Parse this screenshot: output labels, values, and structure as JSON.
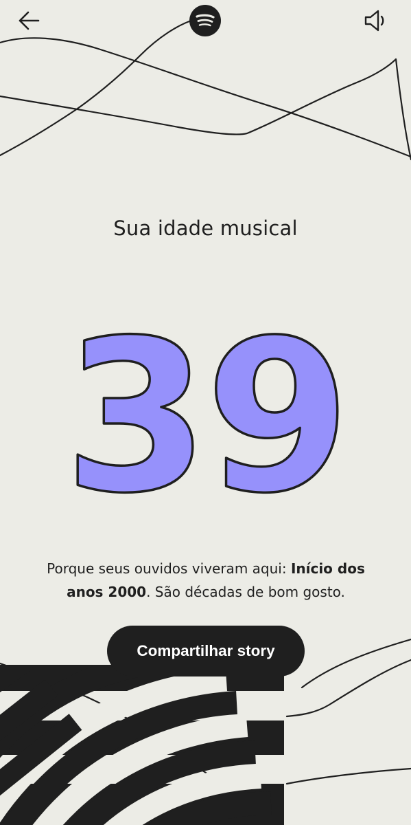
{
  "header": {
    "back_icon": "arrow-left-icon",
    "logo_icon": "spotify-logo-icon",
    "sound_icon": "speaker-icon"
  },
  "main": {
    "title": "Sua idade musical",
    "age": "39",
    "description_prefix": "Porque seus ouvidos viveram aqui: ",
    "description_highlight": "Início dos anos 2000",
    "description_suffix": ". São décadas de bom gosto."
  },
  "actions": {
    "share_label": "Compartilhar story"
  },
  "colors": {
    "background": "#ecece6",
    "ink": "#1f1f1f",
    "number_fill": "#9691fb",
    "button_text": "#ffffff"
  }
}
